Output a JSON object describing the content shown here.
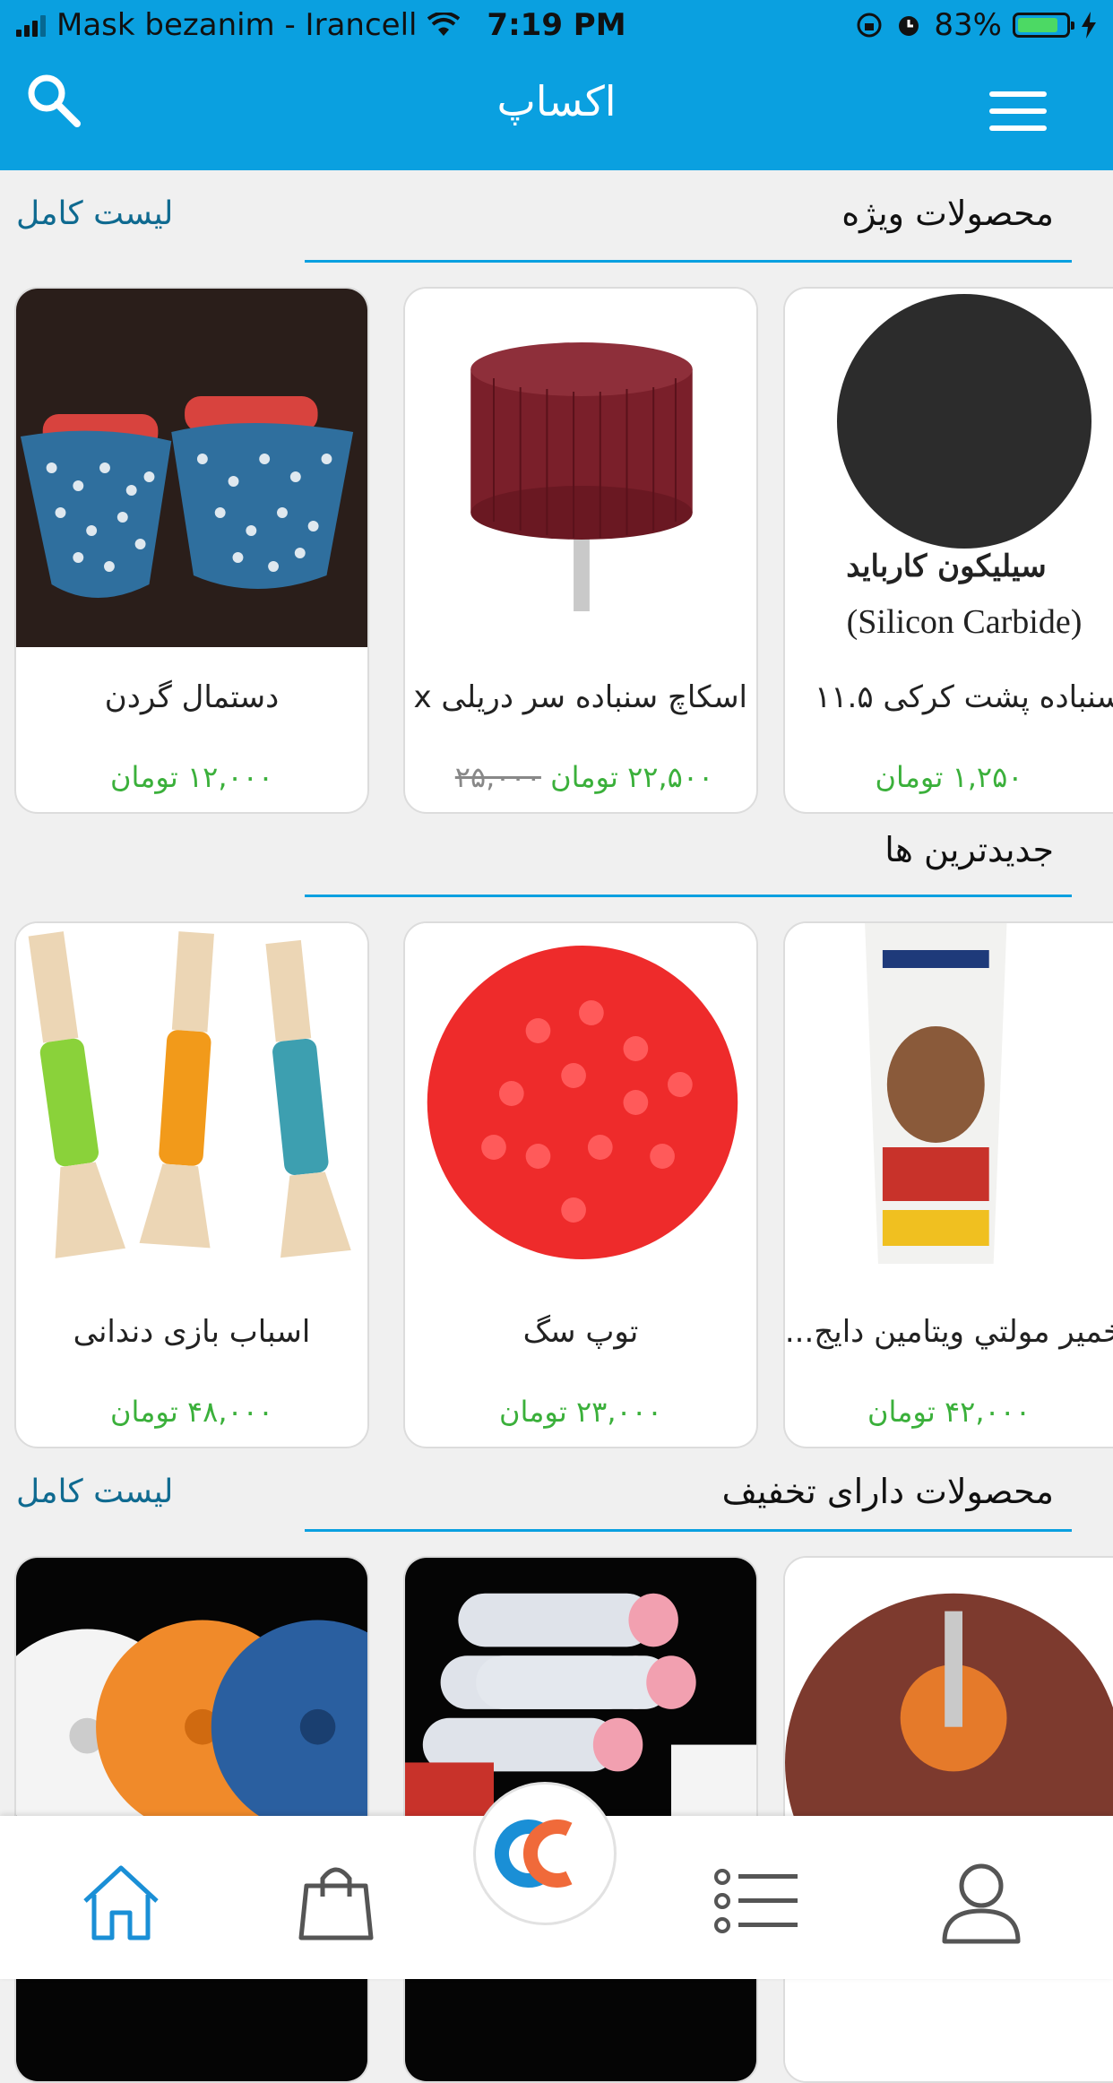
{
  "status_bar": {
    "carrier": "Mask bezanim - Irancell",
    "time": "7:19 PM",
    "battery": "83%",
    "battery_level": 0.83
  },
  "header": {
    "title": "اکساپ",
    "search_icon": "search-icon",
    "menu_icon": "hamburger-menu-icon"
  },
  "sections": [
    {
      "title": "محصولات ویژه",
      "link": "لیست کامل",
      "products": [
        {
          "name": "دستمال گردن",
          "price": "۱۲,۰۰۰ تومان",
          "old_price": ""
        },
        {
          "name": "اسکاچ سنباده سر دریلی x ...",
          "price": "۲۲,۵۰۰ تومان",
          "old_price": "۲۵,۰۰۰"
        },
        {
          "name": "سنباده پشت کرکی ۱۱.۵",
          "price": "۱,۲۵۰ تومان",
          "old_price": "",
          "image_text_fa": "سیلیکون کارباید",
          "image_text_en": "(Silicon Carbide)"
        }
      ]
    },
    {
      "title": "جدیدترین ها",
      "link": "",
      "products": [
        {
          "name": "اسباب بازی دندانی",
          "price": "۴۸,۰۰۰ تومان",
          "old_price": ""
        },
        {
          "name": "توپ سگ",
          "price": "۲۳,۰۰۰ تومان",
          "old_price": ""
        },
        {
          "name": "خمیر مولتي ويتامين دايج...",
          "price": "۴۲,۰۰۰ تومان",
          "old_price": ""
        }
      ]
    },
    {
      "title": "محصولات دارای تخفیف",
      "link": "لیست کامل",
      "products": [
        {
          "name": "",
          "price": "",
          "old_price": ""
        },
        {
          "name": "",
          "price": "",
          "old_price": ""
        },
        {
          "name": "",
          "price": "",
          "old_price": ""
        }
      ]
    }
  ],
  "tabbar": {
    "items": [
      "home-icon",
      "shopping-bag-icon",
      "app-logo-icon",
      "list-icon",
      "profile-icon"
    ],
    "active_color": "#1a8fd6",
    "inactive_color": "#555555"
  },
  "colors": {
    "primary": "#0aa0e0",
    "price": "#3bb03b",
    "link": "#0f6a90"
  }
}
